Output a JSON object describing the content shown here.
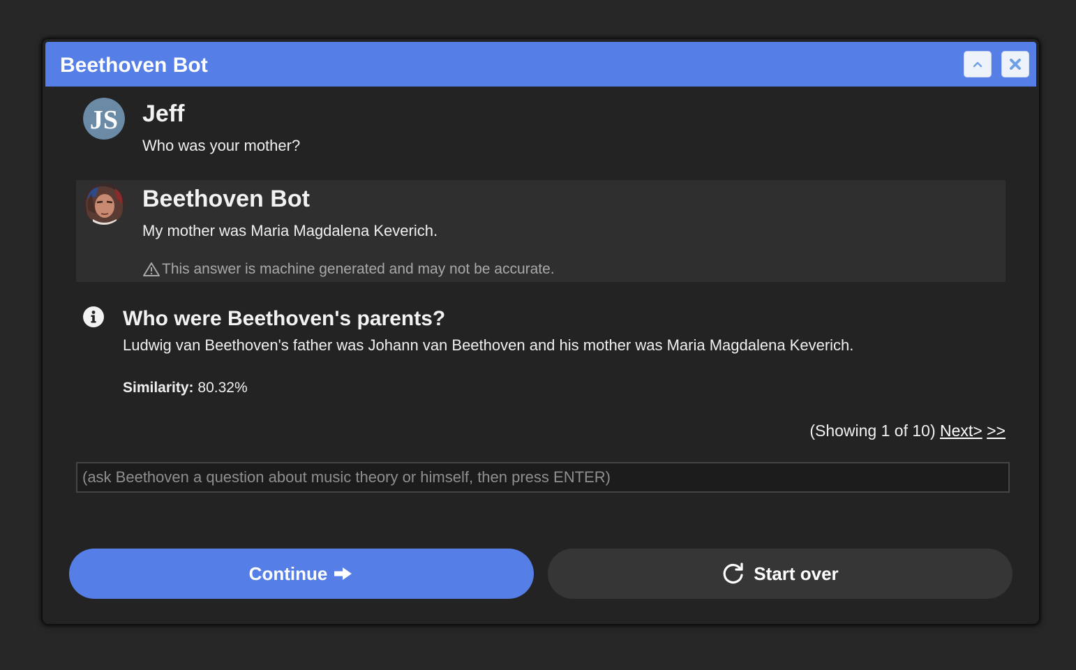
{
  "window": {
    "title": "Beethoven Bot",
    "collapse_icon": "chevron-up-icon",
    "close_icon": "close-icon"
  },
  "conversation": {
    "user": {
      "name": "Jeff",
      "avatar_initials": "JS",
      "message": "Who was your mother?"
    },
    "bot": {
      "name": "Beethoven Bot",
      "message": "My mother was Maria Magdalena Keverich.",
      "disclaimer": "This answer is machine generated and may not be accurate."
    }
  },
  "faq_match": {
    "question": "Who were Beethoven's parents?",
    "answer": "Ludwig van Beethoven's father was Johann van Beethoven and his mother was Maria Magdalena Keverich.",
    "similarity_label": "Similarity:",
    "similarity_value": "80.32%"
  },
  "pager": {
    "status": "(Showing 1 of 10)",
    "next_label": "Next>",
    "last_label": ">>"
  },
  "input": {
    "placeholder": "(ask Beethoven a question about music theory or himself, then press ENTER)",
    "value": ""
  },
  "actions": {
    "continue_label": "Continue",
    "start_over_label": "Start over"
  },
  "colors": {
    "accent": "#557fe6",
    "background": "#232323",
    "bot_bubble": "#2f2f2f"
  }
}
